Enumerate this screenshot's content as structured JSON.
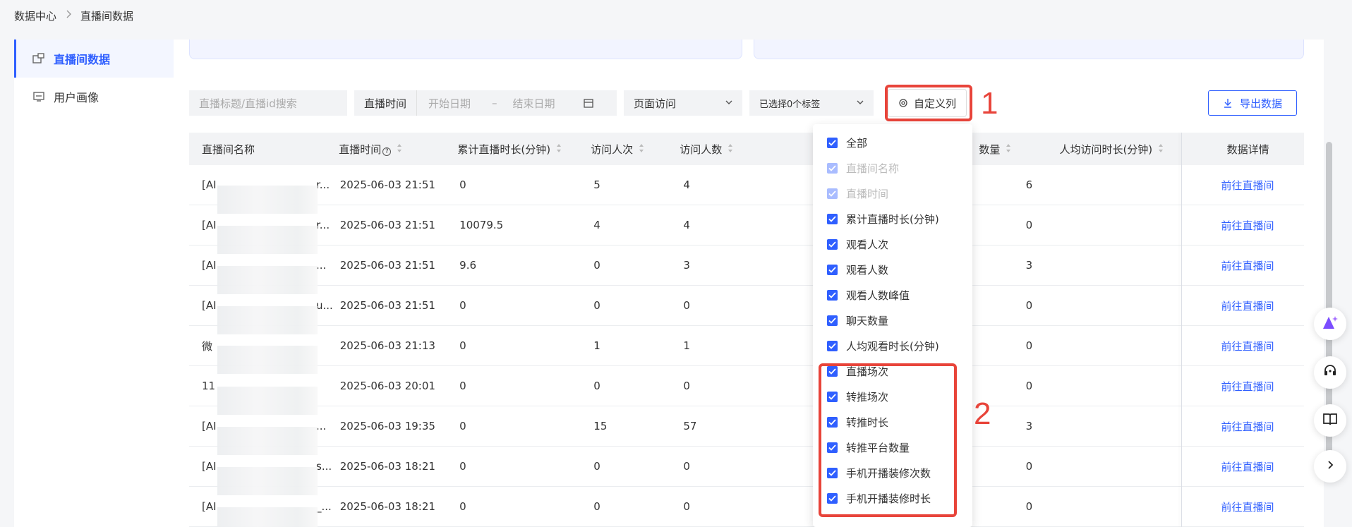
{
  "breadcrumb": {
    "root": "数据中心",
    "current": "直播间数据"
  },
  "sidebar": {
    "items": [
      {
        "label": "直播间数据"
      },
      {
        "label": "用户画像"
      }
    ]
  },
  "toolbar": {
    "search_placeholder": "直播标题/直播id搜索",
    "date_label": "直播时间",
    "start_placeholder": "开始日期",
    "dash": "–",
    "end_placeholder": "结束日期",
    "page_select": "页面访问",
    "tag_select": "已选择0个标签",
    "custom_columns": "自定义列",
    "export": "导出数据"
  },
  "annotations": {
    "one": "1",
    "two": "2"
  },
  "table": {
    "headers": [
      "直播间名称",
      "直播时间",
      "累计直播时长(分钟)",
      "访问人次",
      "访问人数",
      "数量",
      "人均访问时长(分钟)",
      "数据详情"
    ],
    "rows": [
      {
        "name": "[AI",
        "name_tail": "r...",
        "time": "2025-06-03 21:51",
        "dur": "0",
        "visits": "5",
        "visitors": "4",
        "avg": "6",
        "link": "前往直播间"
      },
      {
        "name": "[AI",
        "name_tail": "r...",
        "time": "2025-06-03 21:51",
        "dur": "10079.5",
        "visits": "4",
        "visitors": "4",
        "avg": "0",
        "link": "前往直播间"
      },
      {
        "name": "[AI",
        "name_tail": "...",
        "time": "2025-06-03 21:51",
        "dur": "9.6",
        "visits": "0",
        "visitors": "3",
        "avg": "3",
        "link": "前往直播间"
      },
      {
        "name": "[AI",
        "name_tail": "u...",
        "time": "2025-06-03 21:51",
        "dur": "0",
        "visits": "0",
        "visitors": "0",
        "avg": "0",
        "link": "前往直播间"
      },
      {
        "name": "微",
        "name_tail": "",
        "time": "2025-06-03 21:13",
        "dur": "0",
        "visits": "1",
        "visitors": "1",
        "avg": "0",
        "link": "前往直播间"
      },
      {
        "name": "11",
        "name_tail": "",
        "time": "2025-06-03 20:01",
        "dur": "0",
        "visits": "0",
        "visitors": "0",
        "avg": "0",
        "link": "前往直播间"
      },
      {
        "name": "[AI",
        "name_tail": "...",
        "time": "2025-06-03 19:35",
        "dur": "0",
        "visits": "15",
        "visitors": "57",
        "avg": "3",
        "link": "前往直播间"
      },
      {
        "name": "[AI",
        "name_tail": "s...",
        "time": "2025-06-03 18:21",
        "dur": "0",
        "visits": "0",
        "visitors": "0",
        "avg": "0",
        "link": "前往直播间"
      },
      {
        "name": "[AI",
        "name_tail": "_...",
        "time": "2025-06-03 18:21",
        "dur": "0",
        "visits": "0",
        "visitors": "0",
        "avg": "0",
        "link": "前往直播间"
      }
    ]
  },
  "dropdown": {
    "options": [
      {
        "label": "全部",
        "disabled": false
      },
      {
        "label": "直播间名称",
        "disabled": true
      },
      {
        "label": "直播时间",
        "disabled": true
      },
      {
        "label": "累计直播时长(分钟)",
        "disabled": false
      },
      {
        "label": "观看人次",
        "disabled": false
      },
      {
        "label": "观看人数",
        "disabled": false
      },
      {
        "label": "观看人数峰值",
        "disabled": false
      },
      {
        "label": "聊天数量",
        "disabled": false
      },
      {
        "label": "人均观看时长(分钟)",
        "disabled": false
      },
      {
        "label": "直播场次",
        "disabled": false
      },
      {
        "label": "转推场次",
        "disabled": false
      },
      {
        "label": "转推时长",
        "disabled": false
      },
      {
        "label": "转推平台数量",
        "disabled": false
      },
      {
        "label": "手机开播装修次数",
        "disabled": false
      },
      {
        "label": "手机开播装修时长",
        "disabled": false
      }
    ]
  },
  "colors": {
    "accent": "#2f5fff",
    "annotation": "#e8443a"
  }
}
